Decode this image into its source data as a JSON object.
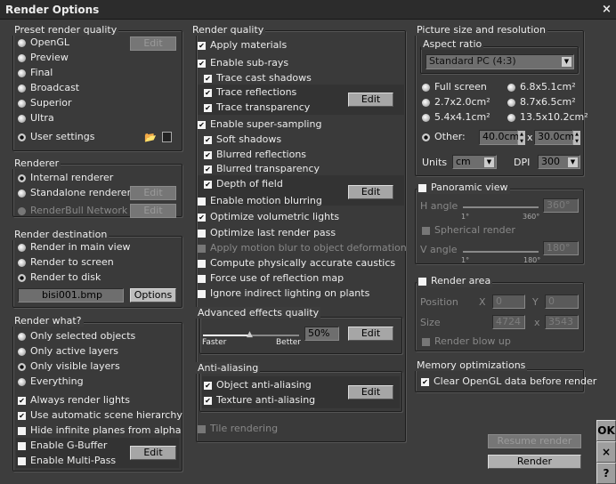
{
  "window": {
    "title": "Render Options",
    "close": "×"
  },
  "preset": {
    "label": "Preset render quality",
    "items": [
      "OpenGL",
      "Preview",
      "Final",
      "Broadcast",
      "Superior",
      "Ultra",
      "User settings"
    ],
    "selected": "User settings",
    "edit": "Edit",
    "icons": [
      "open-folder-icon",
      "save-disk-icon"
    ]
  },
  "renderer": {
    "label": "Renderer",
    "items": [
      "Internal renderer",
      "Standalone renderer",
      "RenderBull Network"
    ],
    "selected": "Internal renderer",
    "edit": "Edit"
  },
  "destination": {
    "label": "Render destination",
    "items": [
      "Render in main view",
      "Render to screen",
      "Render to disk"
    ],
    "selected": "Render to disk",
    "file": "bisi001.bmp",
    "options": "Options"
  },
  "what": {
    "label": "Render what?",
    "radios": [
      "Only selected objects",
      "Only active layers",
      "Only visible layers",
      "Everything"
    ],
    "selected": "Only visible layers",
    "checks": [
      {
        "label": "Always render lights",
        "checked": true
      },
      {
        "label": "Use automatic scene hierarchy",
        "checked": true
      },
      {
        "label": "Hide infinite planes from alpha",
        "checked": false
      },
      {
        "label": "Enable G-Buffer",
        "checked": false
      },
      {
        "label": "Enable Multi-Pass",
        "checked": false
      }
    ],
    "edit": "Edit"
  },
  "quality": {
    "label": "Render quality",
    "items": [
      {
        "label": "Apply materials",
        "checked": true
      },
      {
        "label": "Enable sub-rays",
        "checked": true
      },
      {
        "label": "Trace cast shadows",
        "checked": true
      },
      {
        "label": "Trace reflections",
        "checked": true
      },
      {
        "label": "Trace transparency",
        "checked": true
      },
      {
        "label": "Enable super-sampling",
        "checked": true
      },
      {
        "label": "Soft shadows",
        "checked": true
      },
      {
        "label": "Blurred reflections",
        "checked": true
      },
      {
        "label": "Blurred transparency",
        "checked": true
      },
      {
        "label": "Depth of field",
        "checked": true
      },
      {
        "label": "Enable motion blurring",
        "checked": false
      },
      {
        "label": "Optimize volumetric lights",
        "checked": true
      },
      {
        "label": "Optimize last render pass",
        "checked": false
      },
      {
        "label": "Apply motion blur to object deformation",
        "checked": false,
        "disabled": true
      },
      {
        "label": "Compute physically accurate caustics",
        "checked": false
      },
      {
        "label": "Force use of reflection map",
        "checked": false
      },
      {
        "label": "Ignore indirect lighting on plants",
        "checked": false
      }
    ],
    "edit": "Edit"
  },
  "advanced": {
    "label": "Advanced effects quality",
    "min_label": "Faster",
    "max_label": "Better",
    "value": "50%",
    "level": 0.5,
    "edit": "Edit"
  },
  "antialias": {
    "label": "Anti-aliasing",
    "items": [
      {
        "label": "Object anti-aliasing",
        "checked": true
      },
      {
        "label": "Texture anti-aliasing",
        "checked": true
      }
    ],
    "edit": "Edit"
  },
  "tile": {
    "label": "Tile rendering",
    "checked": false,
    "disabled": true
  },
  "picture": {
    "label": "Picture size and resolution",
    "aspect_label": "Aspect ratio",
    "aspect_value": "Standard PC (4:3)",
    "sizes": [
      "Full screen",
      "6.8x5.1cm²",
      "2.7x2.0cm²",
      "8.7x6.5cm²",
      "5.4x4.1cm²",
      "13.5x10.2cm²"
    ],
    "other": "Other:",
    "selected": "Other:",
    "width": "40.0cm",
    "x": "x",
    "height": "30.0cm",
    "units_label": "Units",
    "units": "cm",
    "dpi_label": "DPI",
    "dpi": "300"
  },
  "panoramic": {
    "label": "Panoramic view",
    "checked": false,
    "h_label": "H angle",
    "h_min": "1°",
    "h_max": "360°",
    "h_value": "360°",
    "spherical": "Spherical render",
    "v_label": "V angle",
    "v_min": "1°",
    "v_max": "180°",
    "v_value": "180°"
  },
  "area": {
    "label": "Render area",
    "checked": false,
    "position": "Position",
    "x_label": "X",
    "x": "0",
    "y_label": "Y",
    "y": "0",
    "size": "Size",
    "w": "4724",
    "sx": "x",
    "h": "3543",
    "blowup": "Render blow up"
  },
  "memory": {
    "label": "Memory optimizations",
    "clear": "Clear OpenGL data before render",
    "checked": true
  },
  "actions": {
    "resume": "Resume render",
    "render": "Render",
    "ok": "OK",
    "cancel": "×",
    "help": "?"
  }
}
